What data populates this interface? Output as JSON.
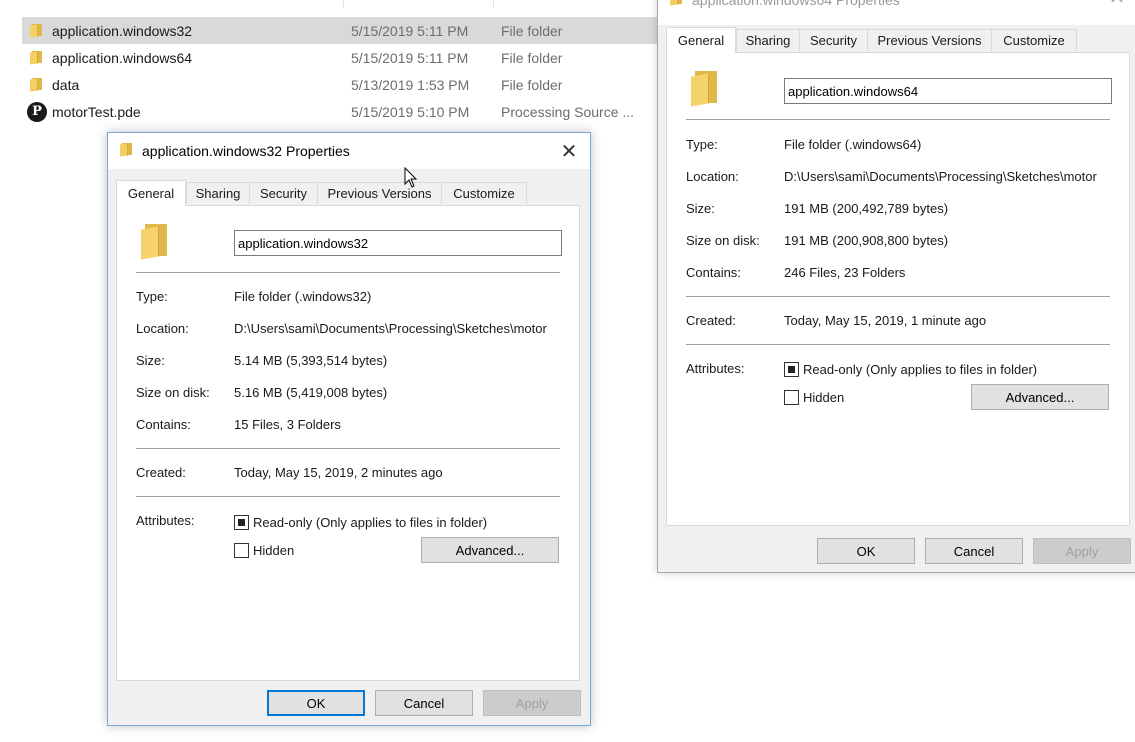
{
  "explorer": {
    "files": [
      {
        "name": "application.windows32",
        "date": "5/15/2019 5:11 PM",
        "type": "File folder",
        "icon": "folder-icon",
        "selected": true
      },
      {
        "name": "application.windows64",
        "date": "5/15/2019 5:11 PM",
        "type": "File folder",
        "icon": "folder-icon",
        "selected": false
      },
      {
        "name": "data",
        "date": "5/13/2019 1:53 PM",
        "type": "File folder",
        "icon": "folder-icon",
        "selected": false
      },
      {
        "name": "motorTest.pde",
        "date": "5/15/2019 5:10 PM",
        "type": "Processing Source ...",
        "icon": "processing-file-icon",
        "selected": false
      }
    ]
  },
  "tabs": [
    "General",
    "Sharing",
    "Security",
    "Previous Versions",
    "Customize"
  ],
  "labels": {
    "type": "Type:",
    "location": "Location:",
    "size": "Size:",
    "size_on_disk": "Size on disk:",
    "contains": "Contains:",
    "created": "Created:",
    "attributes": "Attributes:",
    "readonly": "Read-only (Only applies to files in folder)",
    "hidden": "Hidden",
    "advanced": "Advanced...",
    "ok": "OK",
    "cancel": "Cancel",
    "apply": "Apply"
  },
  "dialog32": {
    "title": "application.windows32 Properties",
    "close_glyph": "✕",
    "name": "application.windows32",
    "type": "File folder (.windows32)",
    "location": "D:\\Users\\sami\\Documents\\Processing\\Sketches\\motor",
    "size": "5.14 MB (5,393,514 bytes)",
    "size_on_disk": "5.16 MB (5,419,008 bytes)",
    "contains": "15 Files, 3 Folders",
    "created": "Today, May 15, 2019, 2 minutes ago",
    "readonly_state": "indeterminate",
    "hidden_checked": false
  },
  "dialog64": {
    "title": "application.windows64 Properties",
    "close_glyph": "✕",
    "name": "application.windows64",
    "type": "File folder (.windows64)",
    "location": "D:\\Users\\sami\\Documents\\Processing\\Sketches\\motor",
    "size": "191 MB (200,492,789 bytes)",
    "size_on_disk": "191 MB (200,908,800 bytes)",
    "contains": "246 Files, 23 Folders",
    "created": "Today, May 15, 2019, 1 minute ago",
    "readonly_state": "indeterminate",
    "hidden_checked": false
  },
  "colors": {
    "accent": "#0078d7",
    "selection": "#d9d9d9",
    "folder": "#f4cf61"
  }
}
